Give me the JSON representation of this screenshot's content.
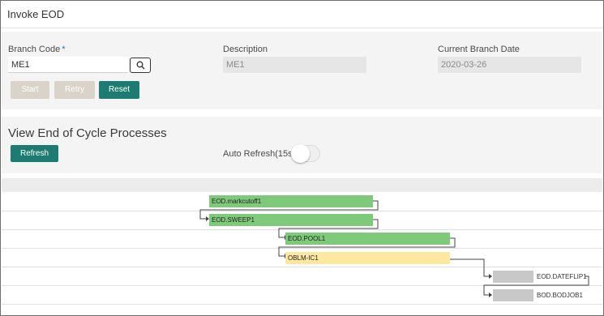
{
  "window": {
    "title": "Invoke EOD"
  },
  "form": {
    "branch_code_label": "Branch Code",
    "required_mark": "*",
    "branch_code_value": "ME1",
    "description_label": "Description",
    "description_value": "ME1",
    "current_branch_date_label": "Current Branch Date",
    "current_branch_date_value": "2020-03-26",
    "buttons": {
      "start": "Start",
      "retry": "Retry",
      "reset": "Reset"
    },
    "search_icon": "search-icon"
  },
  "processes": {
    "heading": "View End of Cycle Processes",
    "refresh_label": "Refresh",
    "auto_refresh_label": "Auto Refresh(15s)",
    "auto_refresh_on": false
  },
  "gantt": {
    "tasks": [
      {
        "name": "EOD.markcutoff1",
        "status": "completed",
        "color": "#7fc97a"
      },
      {
        "name": "EOD.SWEEP1",
        "status": "completed",
        "color": "#7fc97a"
      },
      {
        "name": "EOD.POOL1",
        "status": "completed",
        "color": "#7fc97a"
      },
      {
        "name": "OBLM-IC1",
        "status": "running",
        "color": "#fde7a1"
      },
      {
        "name": "EOD.DATEFLIP1",
        "status": "pending",
        "color": "#c8c8c8"
      },
      {
        "name": "BOD.BODJOB1",
        "status": "pending",
        "color": "#c8c8c8"
      }
    ]
  },
  "colors": {
    "primary": "#1d7b72",
    "disabled": "#d9d3c9",
    "required": "#1f77b4"
  }
}
